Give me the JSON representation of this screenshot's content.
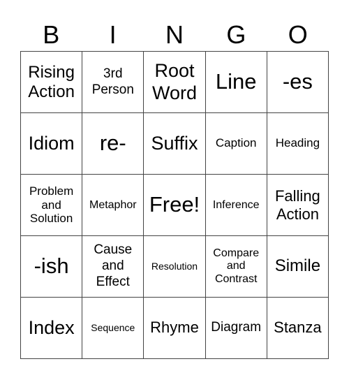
{
  "header": [
    "B",
    "I",
    "N",
    "G",
    "O"
  ],
  "cells": [
    "Rising Action",
    "3rd Person",
    "Root Word",
    "Line",
    "-es",
    "Idiom",
    "re-",
    "Suffix",
    "Caption",
    "Heading",
    "Problem and Solution",
    "Metaphor",
    "Free!",
    "Inference",
    "Falling Action",
    "-ish",
    "Cause and Effect",
    "Resolution",
    "Compare and Contrast",
    "Simile",
    "Index",
    "Sequence",
    "Rhyme",
    "Diagram",
    "Stanza"
  ],
  "colors": {
    "text": "#000000",
    "grid_line": "#444444",
    "background": "#ffffff"
  }
}
